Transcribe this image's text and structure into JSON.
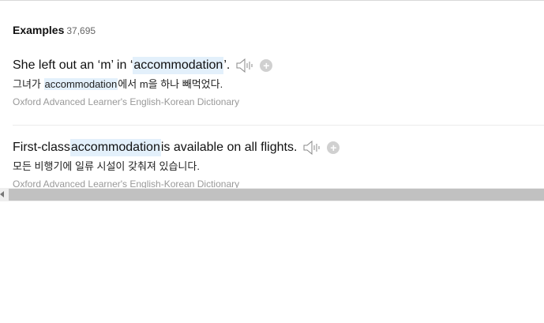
{
  "examples": {
    "title": "Examples",
    "count": "37,695",
    "items": [
      {
        "en_before": "She left out an ‘m’ in ‘",
        "en_highlight": "accommodation",
        "en_after": "’.",
        "ko_before": "그녀가 ",
        "ko_highlight": "accommodation",
        "ko_after": "에서 m을 하나 빼먹었다.",
        "source": "Oxford Advanced Learner's English-Korean Dictionary",
        "audio_icon": "speaker-icon",
        "add_label": "+"
      },
      {
        "en_before": "First-class ",
        "en_highlight": "accommodation",
        "en_after": " is available on all flights.",
        "ko_before": "모든 비행기에 일류 시설이 갖춰져 있습니다.",
        "ko_highlight": "",
        "ko_after": "",
        "source": "Oxford Advanced Learner's English-Korean Dictionary",
        "audio_icon": "speaker-icon",
        "add_label": "+"
      }
    ]
  }
}
